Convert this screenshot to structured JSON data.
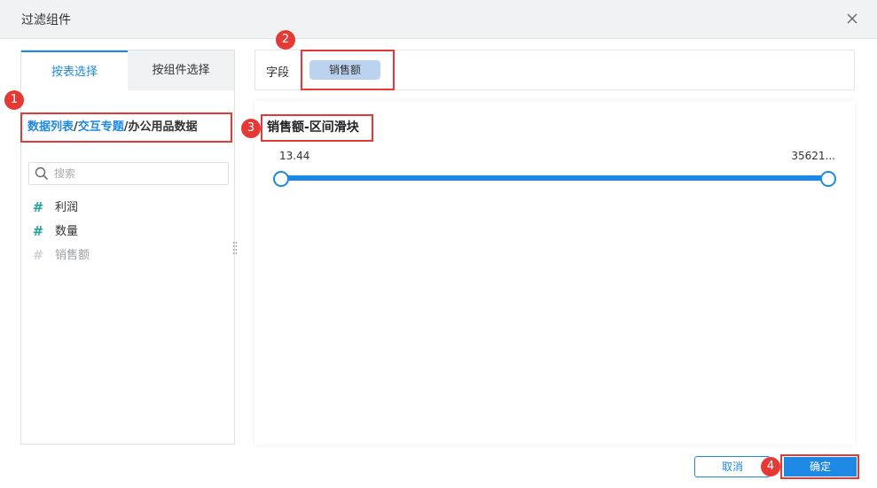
{
  "dialog": {
    "title": "过滤组件"
  },
  "left_panel": {
    "tabs": [
      {
        "label": "按表选择",
        "active": true
      },
      {
        "label": "按组件选择",
        "active": false
      }
    ],
    "breadcrumb": {
      "link1": "数据列表",
      "sep1": "/",
      "link2": "交互专题",
      "sep2": "/",
      "current": "办公用品数据"
    },
    "search": {
      "placeholder": "搜索",
      "value": ""
    },
    "fields": [
      {
        "label": "利润",
        "icon": "hash-icon",
        "enabled": true
      },
      {
        "label": "数量",
        "icon": "hash-icon",
        "enabled": true
      },
      {
        "label": "销售额",
        "icon": "hash-icon",
        "enabled": false
      }
    ]
  },
  "field_bar": {
    "label": "字段",
    "chip": "销售额"
  },
  "preview": {
    "widget_title": "销售额-区间滑块",
    "min_label": "13.44",
    "max_label": "35621..."
  },
  "footer": {
    "cancel_label": "取消",
    "ok_label": "确定"
  },
  "markers": [
    "1",
    "2",
    "3",
    "4"
  ],
  "colors": {
    "accent": "#1e88e5",
    "highlight": "#e53935",
    "field_icon": "#26a69a",
    "chip": "#bcd3ef"
  }
}
